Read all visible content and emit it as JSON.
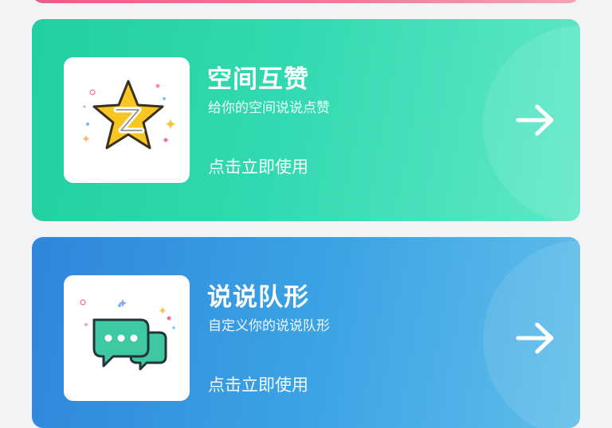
{
  "cards": [
    {
      "title": "空间互赞",
      "subtitle": "给你的空间说说点赞",
      "action_label": "点击立即使用",
      "icon": "qzone-star-icon",
      "accent": "#2ed3a8"
    },
    {
      "title": "说说队形",
      "subtitle": "自定义你的说说队形",
      "action_label": "点击立即使用",
      "icon": "chat-bubbles-icon",
      "accent": "#3596df"
    }
  ],
  "colors": {
    "top_card": "#ef5a86",
    "background": "#f2f3f5",
    "star_fill": "#f7c623",
    "star_outline": "#3b2f1d",
    "bubble_fill": "#3ec9a3"
  }
}
